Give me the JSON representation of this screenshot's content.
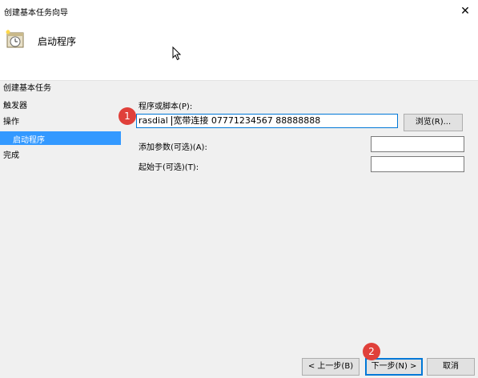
{
  "window": {
    "title": "创建基本任务向导",
    "close_glyph": "✕"
  },
  "header": {
    "title": "启动程序"
  },
  "steps": [
    {
      "label": "创建基本任务"
    },
    {
      "label": "触发器"
    },
    {
      "label": "操作"
    },
    {
      "label": "启动程序",
      "active": true
    },
    {
      "label": "完成"
    }
  ],
  "form": {
    "program_label": "程序或脚本(P):",
    "program_value_before_cursor": "rasdial ",
    "program_value_after_cursor": "宽带连接 07771234567  88888888",
    "browse_label": "浏览(R)...",
    "args_label": "添加参数(可选)(A):",
    "args_value": "",
    "start_label": "起始于(可选)(T):",
    "start_value": ""
  },
  "buttons": {
    "back": "< 上一步(B)",
    "next": "下一步(N) >",
    "cancel": "取消"
  },
  "annotations": {
    "badge1": "1",
    "badge2": "2",
    "badge_color": "#e0403a"
  },
  "colors": {
    "accent": "#3399ff",
    "focus_border": "#0078d7"
  }
}
